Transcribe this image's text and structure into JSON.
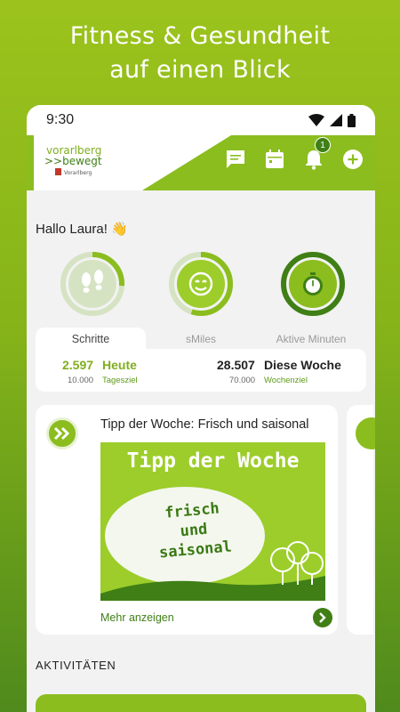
{
  "promo": {
    "line1": "Fitness & Gesundheit",
    "line2": "auf einen Blick"
  },
  "status_bar": {
    "time": "9:30",
    "icons": [
      "wifi-icon",
      "signal-icon",
      "battery-icon"
    ]
  },
  "header": {
    "logo_text": "vorarlberg",
    "logo_sub": ">>bewegt",
    "logo_tag": "Vorarlberg",
    "icons": [
      "chat-icon",
      "calendar-icon",
      "bell-icon",
      "add-icon"
    ],
    "notification_count": "1"
  },
  "greeting": "Hallo Laura! 👋",
  "rings": [
    {
      "icon": "footsteps-icon",
      "progress": 0.26
    },
    {
      "icon": "smiley-icon",
      "progress": 0.55
    },
    {
      "icon": "stopwatch-icon",
      "progress": 1.0
    }
  ],
  "tabs": [
    {
      "label": "Schritte",
      "active": true
    },
    {
      "label": "sMiles",
      "active": false
    },
    {
      "label": "Aktive Minuten",
      "active": false
    }
  ],
  "stats": {
    "today_value": "2.597",
    "today_label": "Heute",
    "today_goal": "10.000",
    "today_goal_label": "Tagesziel",
    "week_value": "28.507",
    "week_label": "Diese Woche",
    "week_goal": "70.000",
    "week_goal_label": "Wochenziel"
  },
  "tip": {
    "title": "Tipp der Woche: Frisch und saisonal",
    "image_heading": "Tipp der Woche",
    "image_line1": "frisch",
    "image_line2": "und",
    "image_line3": "saisonal",
    "more_label": "Mehr anzeigen"
  },
  "activities": {
    "title": "AKTIVITÄTEN"
  },
  "colors": {
    "brand_green": "#8bbd1f",
    "dark_green": "#3f7f16",
    "ring_light": "#d5e3c2"
  }
}
